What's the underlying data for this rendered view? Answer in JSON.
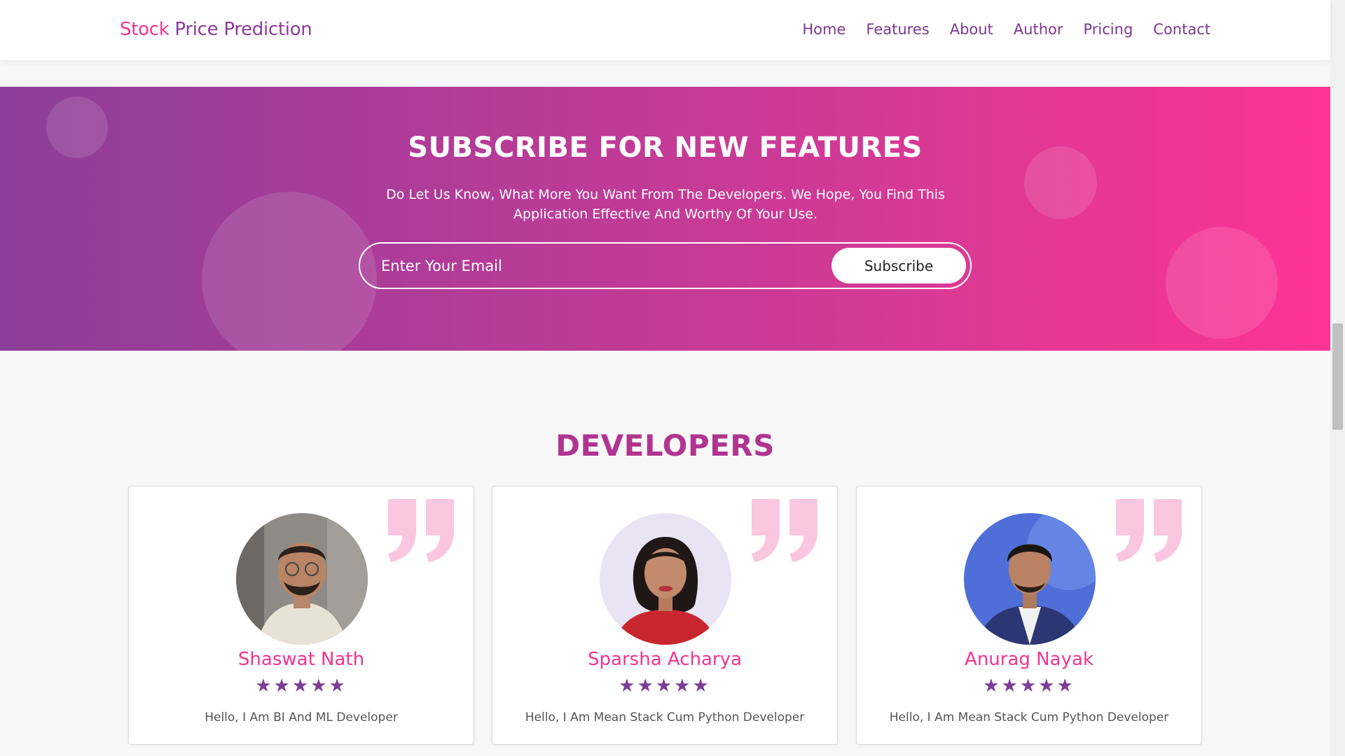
{
  "navbar": {
    "brand_accent": "Stock",
    "brand_rest": " Price Prediction",
    "links": [
      "Home",
      "Features",
      "About",
      "Author",
      "Pricing",
      "Contact"
    ]
  },
  "subscribe": {
    "title": "SUBSCRIBE FOR NEW FEATURES",
    "text": "Do Let Us Know, What More You Want From The Developers. We Hope, You Find This Application Effective And Worthy Of Your Use.",
    "email_placeholder": "Enter Your Email",
    "email_value": "",
    "button_label": "Subscribe"
  },
  "developers": {
    "title": "DEVELOPERS",
    "cards": [
      {
        "name": "Shaswat Nath",
        "rating": 5,
        "stars": "★★★★★",
        "description": "Hello, I Am BI And ML Developer",
        "quote_icon": "quote-icon"
      },
      {
        "name": "Sparsha Acharya",
        "rating": 5,
        "stars": "★★★★★",
        "description": "Hello, I Am Mean Stack Cum Python Developer",
        "quote_icon": "quote-icon"
      },
      {
        "name": "Anurag Nayak",
        "rating": 5,
        "stars": "★★★★★",
        "description": "Hello, I Am Mean Stack Cum Python Developer",
        "quote_icon": "quote-icon"
      }
    ]
  },
  "colors": {
    "brand_pink": "#f3348f",
    "brand_purple": "#8e3a9a",
    "gradient_start": "#8b3f98",
    "gradient_end": "#fd3494",
    "star": "#7e3b97",
    "quote": "#fbc6e0"
  }
}
